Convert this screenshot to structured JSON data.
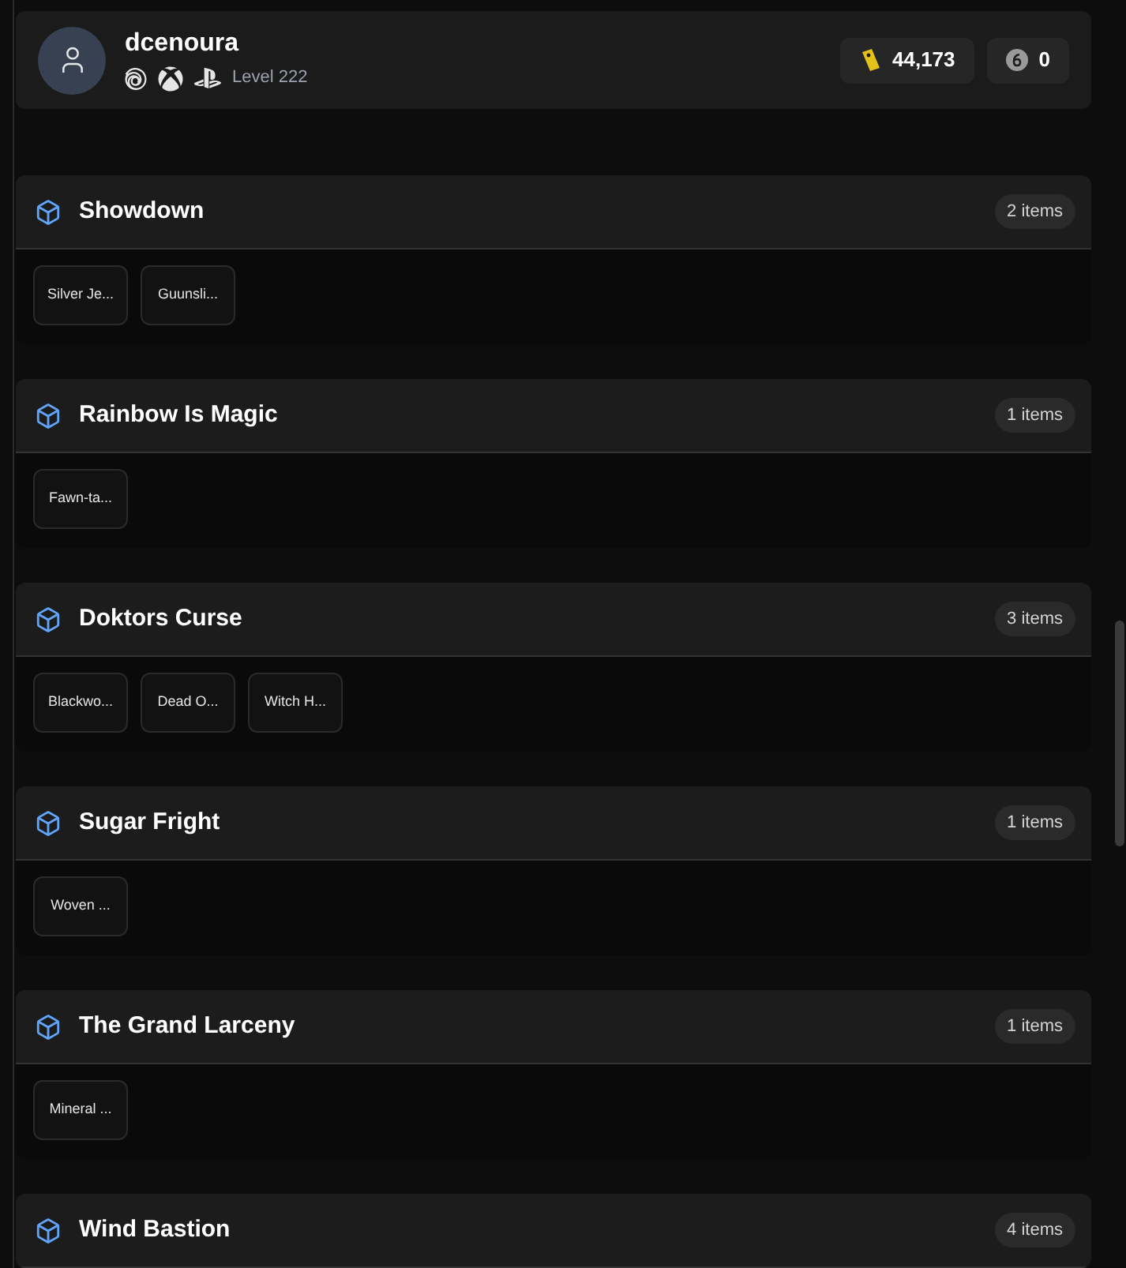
{
  "profile": {
    "username": "dcenoura",
    "level": "Level 222"
  },
  "currencies": [
    {
      "kind": "renown",
      "amount": "44,173"
    },
    {
      "kind": "credits",
      "amount": "0"
    }
  ],
  "collections": [
    {
      "title": "Showdown",
      "count": "2 items",
      "items": [
        "Silver Je...",
        "Guunsli..."
      ]
    },
    {
      "title": "Rainbow Is Magic",
      "count": "1 items",
      "items": [
        "Fawn-ta..."
      ]
    },
    {
      "title": "Doktors Curse",
      "count": "3 items",
      "items": [
        "Blackwo...",
        "Dead O...",
        "Witch H..."
      ]
    },
    {
      "title": "Sugar Fright",
      "count": "1 items",
      "items": [
        "Woven ..."
      ]
    },
    {
      "title": "The Grand Larceny",
      "count": "1 items",
      "items": [
        "Mineral ..."
      ]
    },
    {
      "title": "Wind Bastion",
      "count": "4 items"
    }
  ]
}
